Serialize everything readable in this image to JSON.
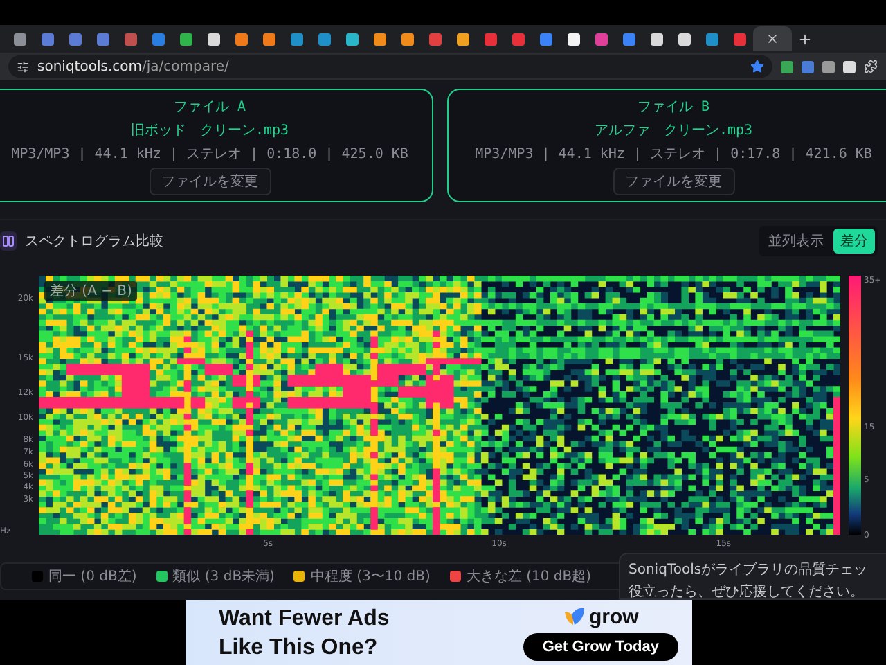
{
  "browser": {
    "tabs": [
      {
        "color": "#8a8f98",
        "selected": false
      },
      {
        "color": "#5b7bd5",
        "selected": false
      },
      {
        "color": "#5b7bd5",
        "selected": false
      },
      {
        "color": "#5b7bd5",
        "selected": false
      },
      {
        "color": "#c0504d",
        "selected": false
      },
      {
        "color": "#2a7de1",
        "selected": false
      },
      {
        "color": "#2fb34a",
        "selected": false
      },
      {
        "color": "#d9d9d9",
        "selected": false
      },
      {
        "color": "#f07a1a",
        "selected": false
      },
      {
        "color": "#f07a1a",
        "selected": false
      },
      {
        "color": "#1f8fc7",
        "selected": false
      },
      {
        "color": "#1f8fc7",
        "selected": false
      },
      {
        "color": "#29b6c9",
        "selected": false
      },
      {
        "color": "#f08a1a",
        "selected": false
      },
      {
        "color": "#f08a1a",
        "selected": false
      },
      {
        "color": "#e04040",
        "selected": false
      },
      {
        "color": "#f0a020",
        "selected": false
      },
      {
        "color": "#e8303a",
        "selected": false
      },
      {
        "color": "#e8303a",
        "selected": false
      },
      {
        "color": "#3b82f6",
        "selected": false
      },
      {
        "color": "#f2f2f2",
        "selected": false
      },
      {
        "color": "#e0409a",
        "selected": false
      },
      {
        "color": "#3b82f6",
        "selected": false
      },
      {
        "color": "#d9d9d9",
        "selected": false
      },
      {
        "color": "#d9d9d9",
        "selected": false
      },
      {
        "color": "#1f8fc7",
        "selected": false
      },
      {
        "color": "#e8303a",
        "selected": false
      },
      {
        "color": "#cccccc",
        "selected": true
      }
    ],
    "url_host": "soniqtools.com",
    "url_path": "/ja/compare/"
  },
  "files": [
    {
      "label": "ファイル A",
      "name": "旧ボッド　クリーン.mp3",
      "meta": "MP3/MP3 | 44.1 kHz | ステレオ | 0:18.0 | 425.0 KB",
      "button": "ファイルを変更"
    },
    {
      "label": "ファイル B",
      "name": "アルファ　クリーン.mp3",
      "meta": "MP3/MP3 | 44.1 kHz | ステレオ | 0:17.8 | 421.6 KB",
      "button": "ファイルを変更"
    }
  ],
  "section": {
    "title": "スペクトログラム比較",
    "views": [
      {
        "label": "並列表示",
        "selected": false
      },
      {
        "label": "差分",
        "selected": true
      }
    ]
  },
  "spectrogram": {
    "overlay_label": "差分 (A − B)",
    "y_labels": [
      "20k",
      "15k",
      "12k",
      "10k",
      "8k",
      "7k",
      "6k",
      "5k",
      "4k",
      "3k"
    ],
    "unit": "Hz",
    "x_labels": [
      "5s",
      "10s",
      "15s"
    ],
    "scale_labels": [
      "35+",
      "15",
      "5",
      "0"
    ]
  },
  "legend": [
    {
      "label": "同一 (0 dB差)",
      "color": "#000000"
    },
    {
      "label": "類似 (3 dB未満)",
      "color": "#22c55e"
    },
    {
      "label": "中程度 (3〜10 dB)",
      "color": "#eab308"
    },
    {
      "label": "大きな差 (10 dB超)",
      "color": "#ef4444"
    }
  ],
  "toast": {
    "lines": [
      "SoniqToolsがライブラリの品質チェッ",
      "役立ったら、ぜひ応援してください。"
    ]
  },
  "ad": {
    "headline": [
      "Want Fewer Ads",
      "Like This One?"
    ],
    "brand": "grow",
    "cta": "Get Grow Today"
  }
}
